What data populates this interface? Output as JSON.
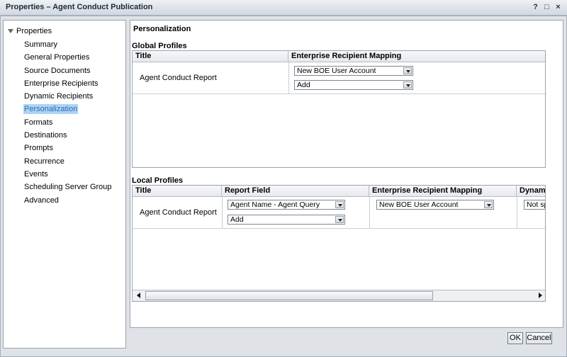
{
  "window": {
    "title": "Properties – Agent Conduct Publication",
    "controls": [
      "?",
      "□",
      "×"
    ]
  },
  "sidebar": {
    "root_label": "Properties",
    "items": [
      {
        "label": "Summary",
        "selected": false
      },
      {
        "label": "General Properties",
        "selected": false
      },
      {
        "label": "Source Documents",
        "selected": false
      },
      {
        "label": "Enterprise Recipients",
        "selected": false
      },
      {
        "label": "Dynamic Recipients",
        "selected": false
      },
      {
        "label": "Personalization",
        "selected": true
      },
      {
        "label": "Formats",
        "selected": false
      },
      {
        "label": "Destinations",
        "selected": false
      },
      {
        "label": "Prompts",
        "selected": false
      },
      {
        "label": "Recurrence",
        "selected": false
      },
      {
        "label": "Events",
        "selected": false
      },
      {
        "label": "Scheduling Server Group",
        "selected": false
      },
      {
        "label": "Advanced",
        "selected": false
      }
    ]
  },
  "main": {
    "page_title": "Personalization",
    "global_profiles": {
      "heading": "Global Profiles",
      "columns": [
        "Title",
        "Enterprise Recipient Mapping"
      ],
      "row": {
        "title": "Agent Conduct Report",
        "mapping_select": "New BOE User Account",
        "add_select": "Add"
      }
    },
    "local_profiles": {
      "heading": "Local Profiles",
      "columns": [
        "Title",
        "Report Field",
        "Enterprise Recipient Mapping",
        "Dynamic"
      ],
      "row": {
        "title": "Agent Conduct Report",
        "report_field_select": "Agent Name - Agent Query",
        "add_select": "Add",
        "mapping_select": "New BOE User Account",
        "dynamic_select": "Not sp"
      }
    }
  },
  "footer": {
    "ok_label": "OK",
    "cancel_label": "Cancel"
  }
}
